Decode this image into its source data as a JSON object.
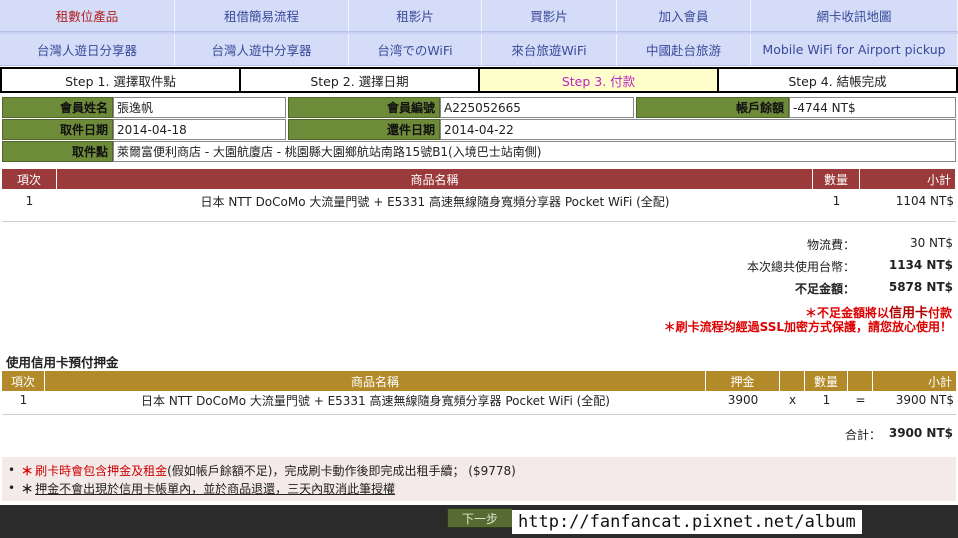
{
  "nav": {
    "row1": [
      "租數位產品",
      "租借簡易流程",
      "租影片",
      "買影片",
      "加入會員",
      "網卡收訊地圖"
    ],
    "row2": [
      "台灣人遊日分享器",
      "台灣人遊中分享器",
      "台湾でのWiFi",
      "來台旅遊WiFi",
      "中國赴台旅游",
      "Mobile WiFi for Airport pickup"
    ]
  },
  "steps": [
    "Step 1. 選擇取件點",
    "Step 2. 選擇日期",
    "Step 3. 付款",
    "Step 4. 結帳完成"
  ],
  "info": {
    "member_name_label": "會員姓名",
    "member_name": "張逸帆",
    "member_id_label": "會員編號",
    "member_id": "A225052665",
    "balance_label": "帳戶餘額",
    "balance": "-4744 NT$",
    "pickup_date_label": "取件日期",
    "pickup_date": "2014-04-18",
    "return_date_label": "還件日期",
    "return_date": "2014-04-22",
    "pickup_point_label": "取件點",
    "pickup_point": "萊爾富便利商店 - 大園航廈店 - 桃園縣大園鄉航站南路15號B1(入境巴士站南側)"
  },
  "order": {
    "headers": [
      "項次",
      "商品名稱",
      "數量",
      "小計"
    ],
    "rows": [
      {
        "idx": "1",
        "name": "日本 NTT DoCoMo 大流量門號 + E5331 高速無線隨身寬頻分享器 Pocket WiFi (全配)",
        "qty": "1",
        "subtotal": "1104 NT$"
      }
    ]
  },
  "summary": {
    "shipping_label": "物流費：",
    "shipping": "30 NT$",
    "total_label": "本次總共使用台幣：",
    "total": "1134 NT$",
    "shortfall_label": "不足金額：",
    "shortfall": "5878 NT$",
    "alert1_prefix": "＊不足金額將以",
    "alert1_bold": "信用卡",
    "alert1_suffix": "付款",
    "alert2": "＊刷卡流程均經過SSL加密方式保護，請您放心使用！"
  },
  "deposit": {
    "title": "使用信用卡預付押金",
    "headers": [
      "項次",
      "商品名稱",
      "押金",
      "",
      "數量",
      "",
      "小計"
    ],
    "rows": [
      {
        "idx": "1",
        "name": "日本 NTT DoCoMo 大流量門號 + E5331 高速無線隨身寬頻分享器 Pocket WiFi (全配)",
        "deposit": "3900",
        "x": "x",
        "qty": "1",
        "eq": "=",
        "subtotal": "3900 NT$"
      }
    ],
    "sum_label": "合計：",
    "sum": "3900 NT$"
  },
  "notes": {
    "n1_red": "刷卡時會包含押金及租金",
    "n1_rest": " (假如帳戶餘額不足)，完成刷卡動作後即完成出租手續； ($9778)",
    "n2_u": "押金不會出現於信用卡帳單內，並於商品退還，三天內取消此筆授權"
  },
  "next_label": "下一步",
  "watermark": "http://fanfancat.pixnet.net/album"
}
